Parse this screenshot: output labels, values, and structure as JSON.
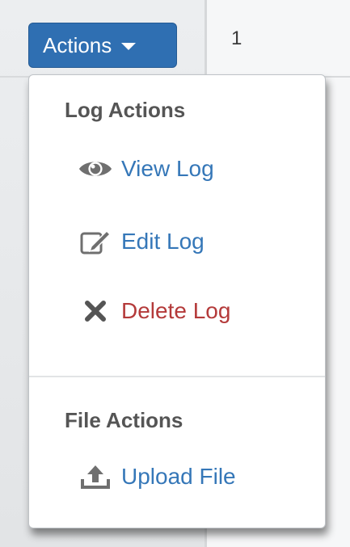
{
  "table": {
    "row_number": "1"
  },
  "actions_button": {
    "label": "Actions",
    "color": "#2f6fb2"
  },
  "menu": {
    "log_header": "Log Actions",
    "file_header": "File Actions",
    "items": [
      {
        "label": "View Log",
        "icon": "eye-icon",
        "color": "#3577b8"
      },
      {
        "label": "Edit Log",
        "icon": "edit-icon",
        "color": "#3577b8"
      },
      {
        "label": "Delete Log",
        "icon": "close-icon",
        "color": "#b43a3a"
      },
      {
        "label": "Upload File",
        "icon": "upload-icon",
        "color": "#3577b8"
      }
    ]
  }
}
